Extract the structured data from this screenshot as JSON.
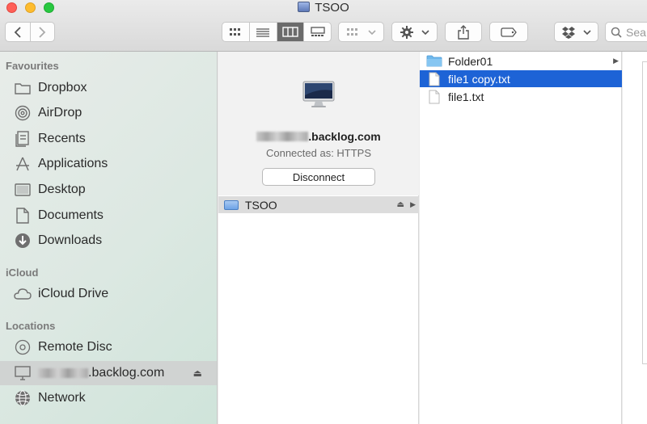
{
  "window": {
    "title": "TSOO"
  },
  "toolbar": {
    "back_icon": "chevron-left-icon",
    "forward_icon": "chevron-right-icon",
    "search_placeholder": "Sea"
  },
  "sidebar": {
    "favourites_header": "Favourites",
    "favourites": [
      {
        "label": "Dropbox",
        "icon": "folder-icon"
      },
      {
        "label": "AirDrop",
        "icon": "airdrop-icon"
      },
      {
        "label": "Recents",
        "icon": "recents-icon"
      },
      {
        "label": "Applications",
        "icon": "applications-icon"
      },
      {
        "label": "Desktop",
        "icon": "desktop-icon"
      },
      {
        "label": "Documents",
        "icon": "documents-icon"
      },
      {
        "label": "Downloads",
        "icon": "downloads-icon"
      }
    ],
    "icloud_header": "iCloud",
    "icloud": [
      {
        "label": "iCloud Drive",
        "icon": "cloud-icon"
      }
    ],
    "locations_header": "Locations",
    "locations": [
      {
        "label": "Remote Disc",
        "icon": "disc-icon"
      },
      {
        "label": ".backlog.com",
        "icon": "display-icon",
        "selected": true
      },
      {
        "label": "Network",
        "icon": "globe-icon"
      }
    ]
  },
  "server": {
    "name_suffix": ".backlog.com",
    "connected_as": "Connected as: HTTPS",
    "disconnect_label": "Disconnect",
    "volume_label": "TSOO"
  },
  "files": [
    {
      "name": "Folder01",
      "type": "folder"
    },
    {
      "name": "file1 copy.txt",
      "type": "text",
      "selected": true
    },
    {
      "name": "file1.txt",
      "type": "text"
    }
  ],
  "colors": {
    "selection": "#1d63d6",
    "folder": "#6fb8ec"
  }
}
